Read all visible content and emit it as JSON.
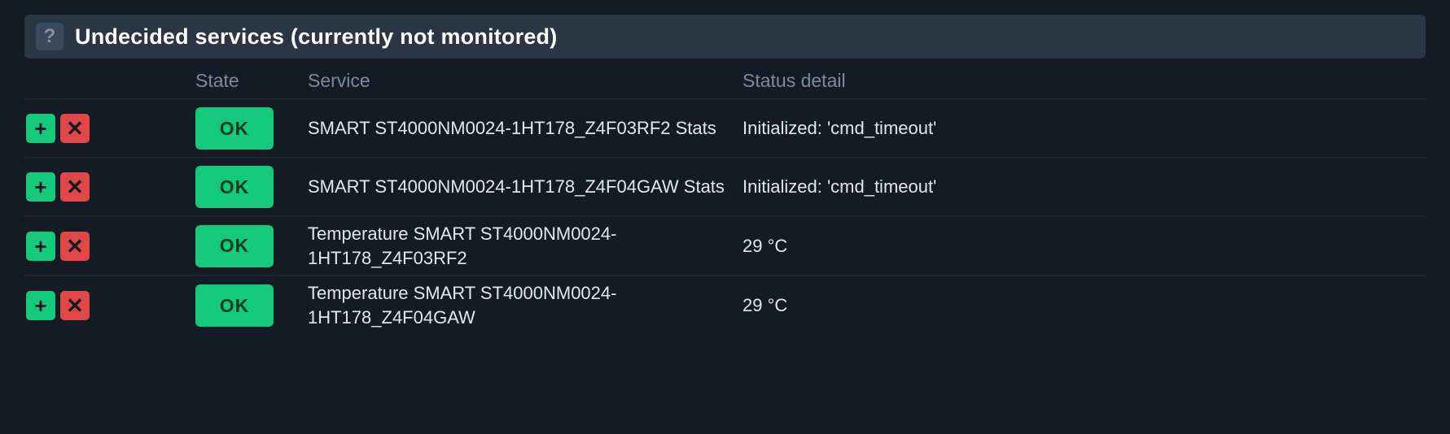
{
  "panel": {
    "title": "Undecided services (currently not monitored)",
    "help_glyph": "?"
  },
  "columns": {
    "state": "State",
    "service": "Service",
    "status_detail": "Status detail"
  },
  "icons": {
    "add": "+",
    "del": "✕"
  },
  "rows": [
    {
      "state": "OK",
      "service": "SMART ST4000NM0024-1HT178_Z4F03RF2 Stats",
      "status_detail": "Initialized: 'cmd_timeout'"
    },
    {
      "state": "OK",
      "service": "SMART ST4000NM0024-1HT178_Z4F04GAW Stats",
      "status_detail": "Initialized: 'cmd_timeout'"
    },
    {
      "state": "OK",
      "service": "Temperature SMART ST4000NM0024-1HT178_Z4F03RF2",
      "status_detail": "29 °C"
    },
    {
      "state": "OK",
      "service": "Temperature SMART ST4000NM0024-1HT178_Z4F04GAW",
      "status_detail": "29 °C"
    }
  ]
}
